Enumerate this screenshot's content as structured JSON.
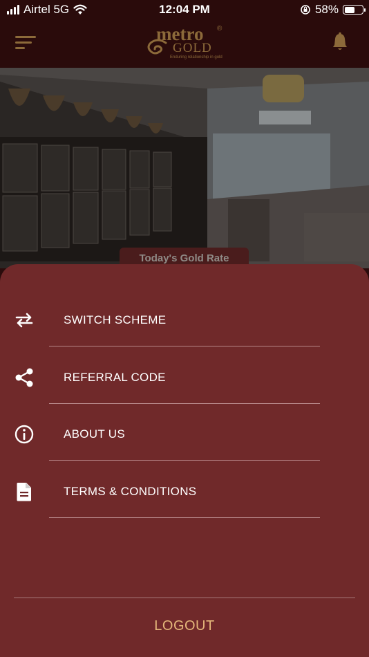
{
  "status_bar": {
    "carrier": "Airtel 5G",
    "time": "12:04 PM",
    "battery": "58%",
    "battery_level": 0.58
  },
  "header": {
    "logo_top": "metro",
    "logo_bottom": "GOLD",
    "logo_tagline": "Enduring relationship in gold",
    "logo_mark": "®"
  },
  "banner": {
    "rate_tab": "Today's Gold Rate"
  },
  "drawer": {
    "items": [
      {
        "label": "SWITCH SCHEME",
        "icon": "swap-arrows-icon"
      },
      {
        "label": "REFERRAL CODE",
        "icon": "share-icon"
      },
      {
        "label": "ABOUT US",
        "icon": "info-icon"
      },
      {
        "label": "TERMS & CONDITIONS",
        "icon": "document-icon"
      }
    ],
    "logout_label": "LOGOUT"
  },
  "colors": {
    "header_bg": "#2a0b0b",
    "drawer_bg": "#70292a",
    "gold": "#8c6a3a",
    "logout": "#e4b77a"
  }
}
